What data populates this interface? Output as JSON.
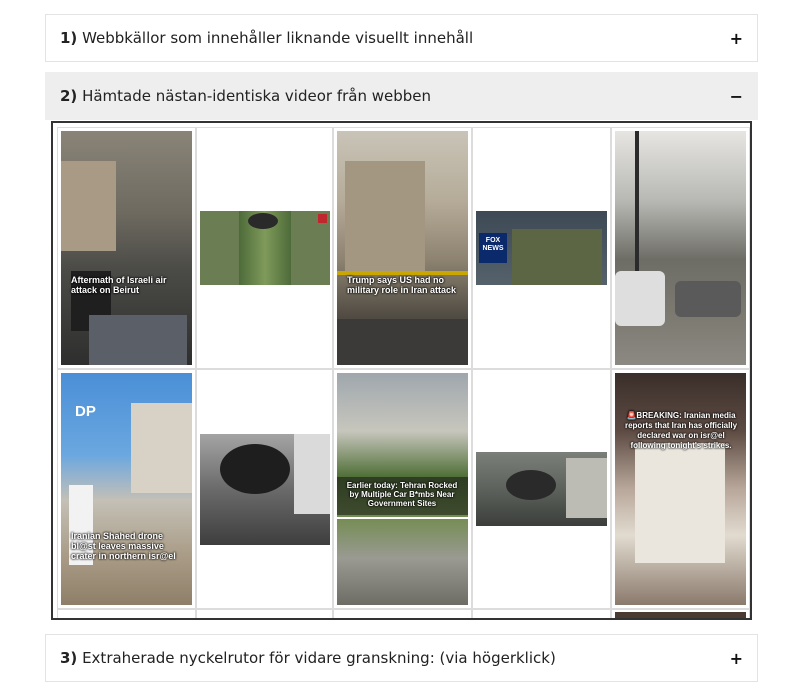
{
  "accordion": [
    {
      "number": "1)",
      "title": "Webbkällor som innehåller liknande visuellt innehåll",
      "toggle": "+"
    },
    {
      "number": "2)",
      "title": "Hämtade nästan-identiska videor från webben",
      "toggle": "−"
    },
    {
      "number": "3)",
      "title": "Extraherade nyckelrutor för vidare granskning: (via högerklick)",
      "toggle": "+"
    }
  ],
  "thumbnails": [
    {
      "caption": "Aftermath of Israeli air attack on Beirut"
    },
    {
      "caption": ""
    },
    {
      "caption": "Trump says US had no military role in Iran attack"
    },
    {
      "caption": "",
      "badge": "FOX NEWS"
    },
    {
      "caption": ""
    },
    {
      "caption": "Iranian Shahed drone bl@st leaves massive crater in northern isr@el",
      "badge": "DP"
    },
    {
      "caption": ""
    },
    {
      "caption": "Earlier today: Tehran Rocked by Multiple Car B*mbs Near Government Sites"
    },
    {
      "caption": ""
    },
    {
      "caption": "🚨BREAKING: Iranian media reports that Iran has officially declared war on isr@el following tonight's strikes."
    }
  ],
  "colors": {
    "open_header_bg": "#eeeeee",
    "border": "#e3e3e3",
    "gallery_border": "#333333"
  }
}
